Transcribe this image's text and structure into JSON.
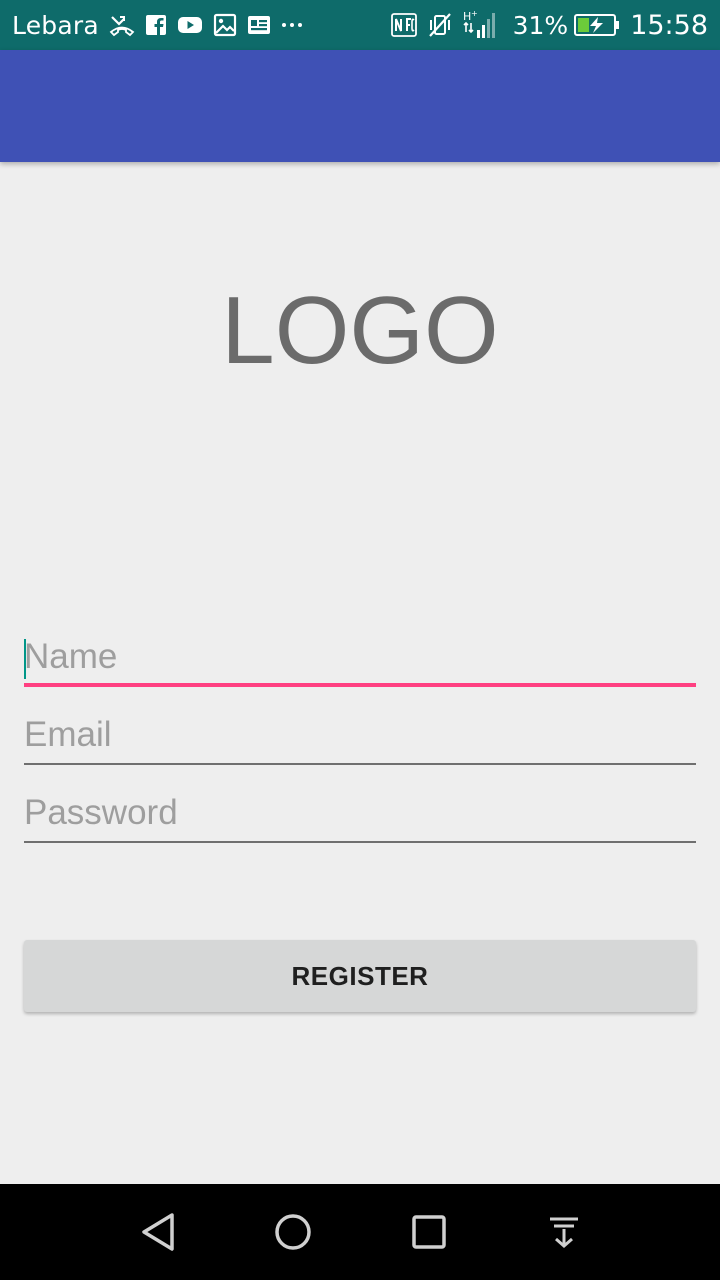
{
  "status_bar": {
    "carrier": "Lebara",
    "battery_percent": "31%",
    "time": "15:58",
    "left_icons": [
      "missed-call-icon",
      "facebook-icon",
      "youtube-icon",
      "image-icon",
      "news-icon",
      "more-icon"
    ],
    "right_icons": [
      "nfc-icon",
      "vibrate-off-icon",
      "signal-icon",
      "battery-charging-icon"
    ]
  },
  "app_bar": {
    "color": "#3f51b5"
  },
  "logo": {
    "text": "LOGO"
  },
  "form": {
    "name_placeholder": "Name",
    "email_placeholder": "Email",
    "password_placeholder": "Password",
    "focused_field": "name",
    "accent_color": "#ff4081",
    "register_label": "REGISTER"
  },
  "nav_bar": {
    "buttons": [
      "back-icon",
      "home-icon",
      "recents-icon",
      "notification-pulldown-icon"
    ]
  }
}
